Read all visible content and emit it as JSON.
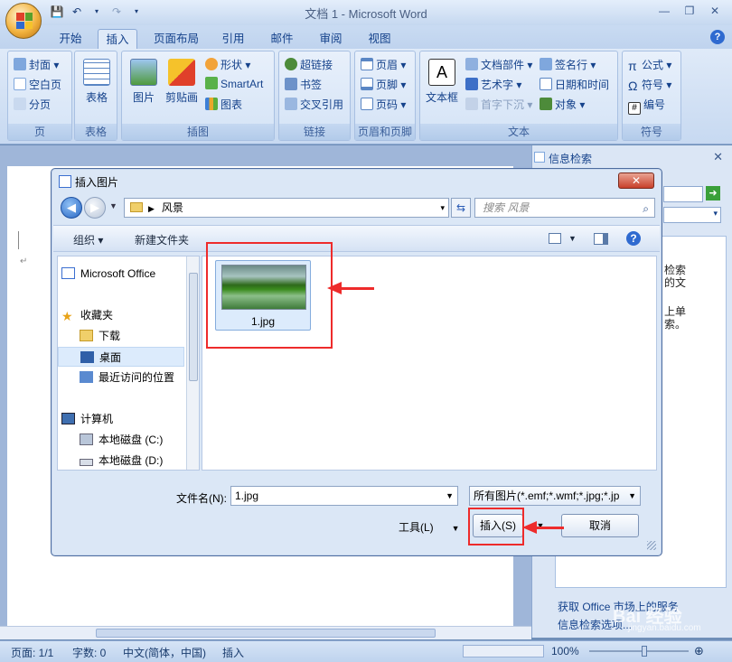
{
  "window": {
    "title": "文档 1 - Microsoft Word",
    "controls": [
      "—",
      "❐",
      "✕"
    ]
  },
  "tabs": [
    "开始",
    "插入",
    "页面布局",
    "引用",
    "邮件",
    "审阅",
    "视图"
  ],
  "active_tab": "插入",
  "ribbon": {
    "pages": {
      "items": [
        "封面 ▾",
        "空白页",
        "分页"
      ],
      "label": "页"
    },
    "tables": {
      "button": "表格",
      "label": "表格"
    },
    "illustrations": {
      "picture": "图片",
      "clipart": "剪贴画",
      "shapes": "形状 ▾",
      "smartart": "SmartArt",
      "chart": "图表",
      "label": "插图"
    },
    "links": {
      "items": [
        "超链接",
        "书签",
        "交叉引用"
      ],
      "label": "链接"
    },
    "header_footer": {
      "items": [
        "页眉 ▾",
        "页脚 ▾",
        "页码 ▾"
      ],
      "label": "页眉和页脚"
    },
    "text": {
      "textbox": "文本框",
      "items_left": [
        "文档部件 ▾",
        "艺术字 ▾",
        "首字下沉 ▾"
      ],
      "items_right": [
        "签名行 ▾",
        "日期和时间",
        "对象 ▾"
      ],
      "label": "文本"
    },
    "symbols": {
      "items": [
        "公式 ▾",
        "符号 ▾",
        "编号"
      ],
      "label": "符号"
    }
  },
  "research_pane": {
    "title": "信息检索",
    "close": "✕",
    "body_lines": [
      "检索",
      "的文",
      "上单",
      "索。"
    ],
    "links": [
      "获取 Office 市场上的服务",
      "信息检索选项..."
    ]
  },
  "dialog": {
    "title": "插入图片",
    "close": "✕",
    "address": "风景",
    "search_placeholder": "搜索 风景",
    "toolbar": {
      "organize": "组织 ▾",
      "new_folder": "新建文件夹"
    },
    "nav_items": [
      {
        "label": "Microsoft Office"
      },
      {
        "label": "收藏夹"
      },
      {
        "label": "下载"
      },
      {
        "label": "桌面"
      },
      {
        "label": "最近访问的位置"
      },
      {
        "label": "计算机"
      },
      {
        "label": "本地磁盘 (C:)"
      },
      {
        "label": "本地磁盘 (D:)"
      }
    ],
    "files": [
      {
        "name": "1.jpg"
      }
    ],
    "filename_label": "文件名(N):",
    "filename_value": "1.jpg",
    "filetype_value": "所有图片(*.emf;*.wmf;*.jpg;*.jp",
    "tools_label": "工具(L)",
    "insert_label": "插入(S)",
    "cancel_label": "取消"
  },
  "statusbar": {
    "page": "页面: 1/1",
    "words": "字数: 0",
    "language": "中文(简体，中国)",
    "mode": "插入",
    "zoom": "100%"
  },
  "watermark": "Bai 经验",
  "watermark_url": "jingyan.baidu.com",
  "colors": {
    "accent": "#15428b",
    "annotation": "#ee2b2b",
    "ribbon": "#dfeaf8"
  }
}
